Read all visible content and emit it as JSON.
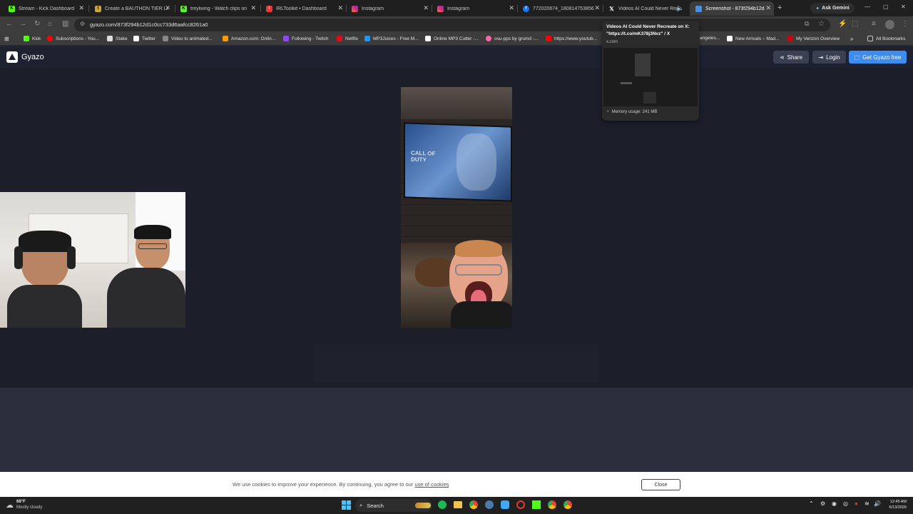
{
  "tabs": [
    {
      "label": "Stream - Kick Dashboard",
      "icon": "kick-icon",
      "color": "#53fc18"
    },
    {
      "label": "Create a BAUTHON TIER LI",
      "icon": "tier-icon",
      "color": "#e0c040"
    },
    {
      "label": "treyliving - Watch clips on",
      "icon": "kick-icon",
      "color": "#53fc18"
    },
    {
      "label": "IRLToolkit • Dashboard",
      "icon": "irl-icon",
      "color": "#e53935"
    },
    {
      "label": "Instagram",
      "icon": "instagram-icon",
      "color": "#e1306c"
    },
    {
      "label": "Instagram",
      "icon": "instagram-icon",
      "color": "#e1306c"
    },
    {
      "label": "772020674_180814753856",
      "icon": "facebook-icon",
      "color": "#1877f2"
    },
    {
      "label": "Videos AI Could Never Rec",
      "icon": "x-icon",
      "color": "#ffffff"
    },
    {
      "label": "Screenshot - 873f294b12d",
      "icon": "gyazo-icon",
      "color": "#4a90e2"
    }
  ],
  "ask_gemini": "Ask Gemini",
  "url": "gyazo.com/873f294b12d1c0cc733d6aafcc8261a0",
  "bookmarks": [
    {
      "label": "Kick",
      "color": "#53fc18"
    },
    {
      "label": "Subscriptions - You...",
      "color": "#ff0000"
    },
    {
      "label": "Stake",
      "color": "#dddddd"
    },
    {
      "label": "Twitter",
      "color": "#ffffff"
    },
    {
      "label": "Video to animated...",
      "color": "#888888"
    },
    {
      "label": "Amazon.com: Onlin...",
      "color": "#ff9900"
    },
    {
      "label": "Following - Twitch",
      "color": "#9146ff"
    },
    {
      "label": "Netflix",
      "color": "#e50914"
    },
    {
      "label": "MP3Juices - Free M...",
      "color": "#2196f3"
    },
    {
      "label": "Online MP3 Cutter -...",
      "color": "#ffffff"
    },
    {
      "label": "osu-pps by grumd -...",
      "color": "#ff66aa"
    },
    {
      "label": "https://www.youtub...",
      "color": "#ff0000"
    },
    {
      "label": "angeles...",
      "color": "#888888"
    },
    {
      "label": "New Arrivals – Mad...",
      "color": "#ffffff"
    },
    {
      "label": "My Verizon Overview",
      "color": "#cd040b"
    }
  ],
  "all_bookmarks": "All Bookmarks",
  "tab_popup": {
    "title": "Videos AI Could Never Recreate on X: \"https://t.co/mK378j3Nvz\" / X",
    "domain": "x.com",
    "memory": "Memory usage: 241 MB"
  },
  "gyazo": {
    "brand": "Gyazo",
    "share": "Share",
    "login": "Login",
    "get_free": "Get Gyazo free"
  },
  "tv_text": "CALL OF DUTY",
  "cookie": {
    "text": "We use cookies to improve your experience. By continuing, you agree to our",
    "link": "use of cookies",
    "close": "Close"
  },
  "taskbar": {
    "weather_temp": "68°F",
    "weather_desc": "Mostly cloudy",
    "search": "Search",
    "time": "12:45 AM",
    "date": "6/13/2026"
  }
}
